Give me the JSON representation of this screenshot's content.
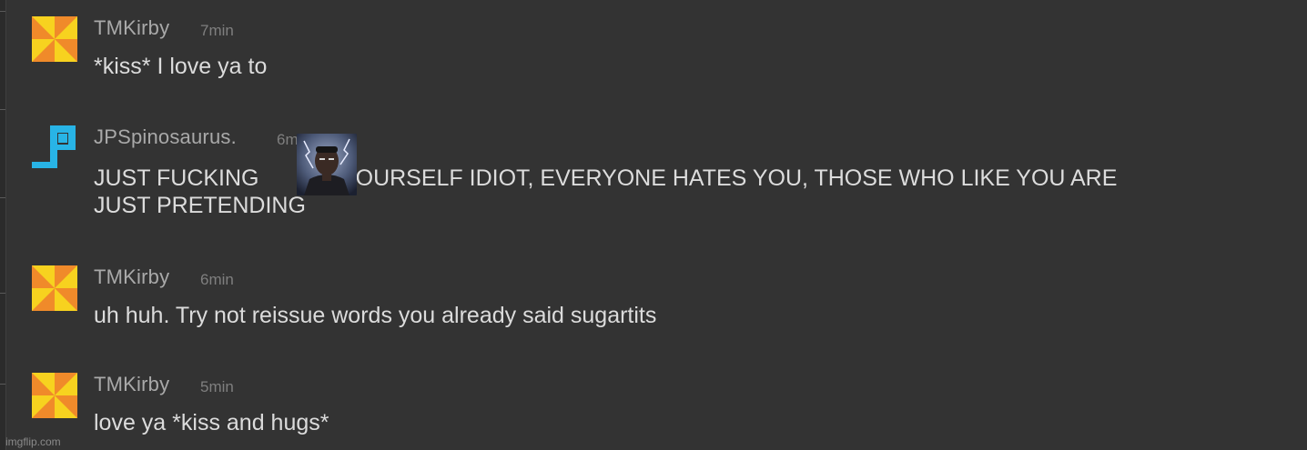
{
  "messages": [
    {
      "username": "TMKirby",
      "time": "7min",
      "text": "*kiss* I love ya to",
      "avatar": "pinwheel-avatar"
    },
    {
      "username": "JPSpinosaurus.",
      "time": "6m",
      "text_part1": "JUST FUCKING",
      "text_part2": "YOURSELF IDIOT, EVERYONE HATES YOU, THOSE WHO LIKE YOU ARE",
      "text_line2": "JUST PRETENDING",
      "avatar": "pixel-logo-avatar",
      "inline_image": "person-with-lightning-emote"
    },
    {
      "username": "TMKirby",
      "time": "6min",
      "text": "uh huh. Try not reissue words you already said sugartits",
      "avatar": "pinwheel-avatar"
    },
    {
      "username": "TMKirby",
      "time": "5min",
      "text": "love ya *kiss and hugs*",
      "avatar": "pinwheel-avatar"
    }
  ],
  "watermark": "imgflip.com",
  "colors": {
    "background": "#333333",
    "pinwheel_yellow": "#f7d21f",
    "pinwheel_orange": "#f08a2a",
    "logo_blue": "#28b4e6"
  }
}
